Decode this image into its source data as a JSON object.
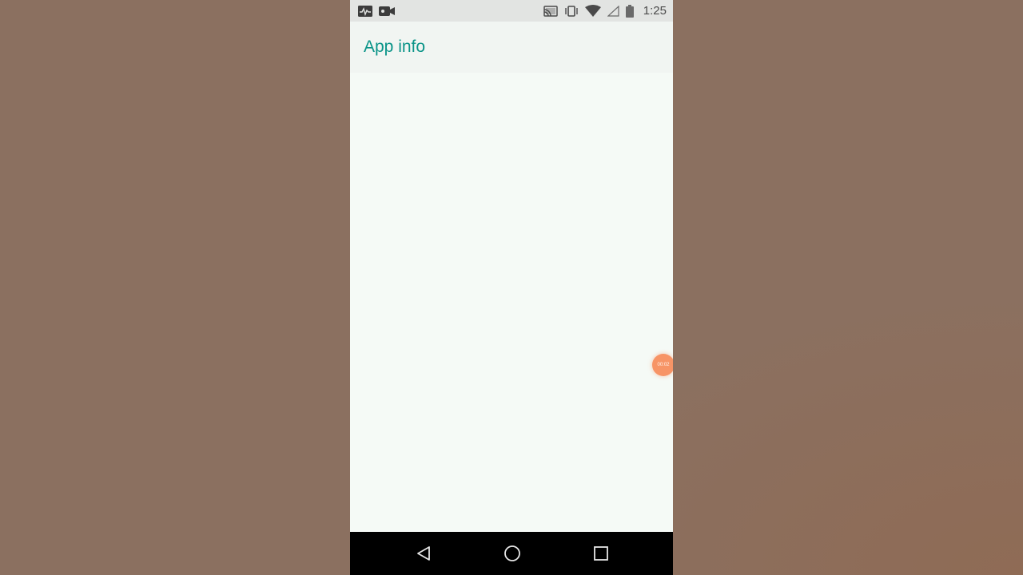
{
  "status_bar": {
    "time": "1:25",
    "icons": [
      "pulse-icon",
      "video-camera-icon",
      "cast-icon",
      "vibrate-icon",
      "wifi-icon",
      "cellular-signal-icon",
      "battery-icon"
    ]
  },
  "app_bar": {
    "title": "App info"
  },
  "screen_recorder": {
    "elapsed": "00:02"
  },
  "navigation": {
    "buttons": [
      "back-icon",
      "home-icon",
      "recents-icon"
    ]
  },
  "colors": {
    "accent": "#0a9488",
    "background_outer": "#8b7060",
    "screen_background": "#f5faf6",
    "status_bar": "#e2e4e2",
    "nav_bar": "#000000",
    "recorder_bubble": "#f79466"
  }
}
